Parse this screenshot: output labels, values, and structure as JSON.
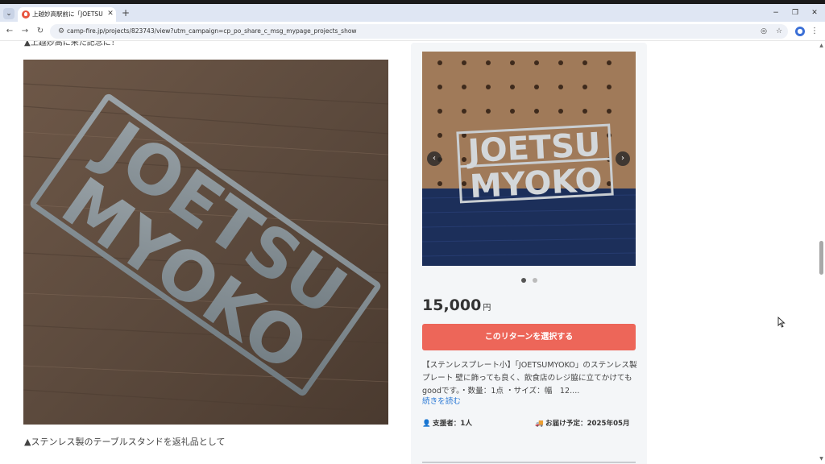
{
  "browser": {
    "tab_list_icon": "chevron-down-icon",
    "tab": {
      "title": "上越妙高駅前に「JOETSU MYOKO」",
      "close_glyph": "✕",
      "favicon": "camp-fire-favicon"
    },
    "new_tab_glyph": "+",
    "window_controls": {
      "minimize": "−",
      "restore": "❐",
      "close": "✕"
    },
    "nav": {
      "back": "←",
      "forward": "→",
      "reload": "↻"
    },
    "url": "camp-fire.jp/projects/823743/view?utm_campaign=cp_po_share_c_msg_mypage_projects_show",
    "omnibox_icons": [
      "eye-off-icon",
      "star-icon"
    ],
    "profile_initial": "👤",
    "menu_glyph": "⋮"
  },
  "page": {
    "cut_caption": "▲上越妙高に来た記念に！",
    "main_image_text": [
      "JOETSU",
      "MYOKO"
    ],
    "caption": "▲ステンレス製のテーブルスタンドを返礼品として"
  },
  "reward": {
    "image_text": [
      "JOETSU",
      "MYOKO"
    ],
    "carousel": {
      "prev": "‹",
      "next": "›",
      "dot_count": 2,
      "active_dot": 0
    },
    "price_amount": "15,000",
    "price_unit": "円",
    "select_label": "このリターンを選択する",
    "description": "【ステンレスプレート小】「JOETSUMYOKO」のステンレス製プレート 壁に飾っても良く、飲食店のレジ脇に立てかけてもgoodです。・数量：1点 ・サイズ：幅　12....",
    "read_more": "続きを読む",
    "supporters": "支援者：1人",
    "delivery": "お届け予定：2025年05月"
  },
  "colors": {
    "accent": "#ed6659",
    "link": "#2e7bd6",
    "card_bg": "#f4f6f8",
    "tab_strip": "#dfe6f3"
  }
}
